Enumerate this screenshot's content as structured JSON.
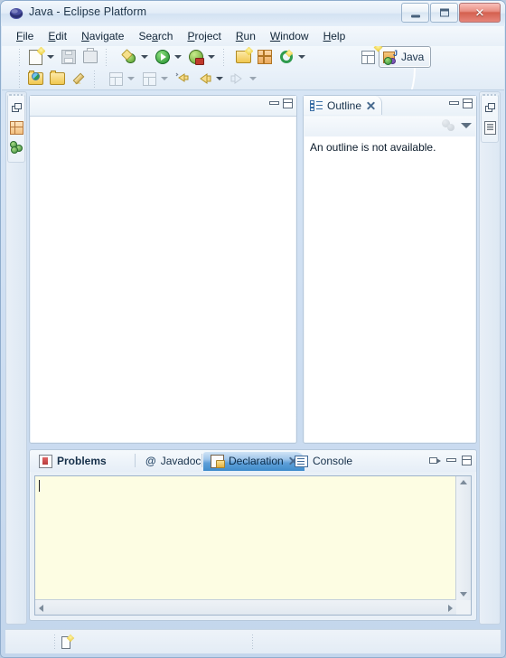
{
  "window": {
    "title": "Java - Eclipse Platform",
    "app_icon": "eclipse-sphere-icon",
    "controls": {
      "minimize": "minimize-button",
      "maximize": "maximize-button",
      "close_glyph": "✕"
    }
  },
  "menubar": {
    "items": [
      {
        "label": "File",
        "mnemonic": "F"
      },
      {
        "label": "Edit",
        "mnemonic": "E"
      },
      {
        "label": "Navigate",
        "mnemonic": "N"
      },
      {
        "label": "Search",
        "mnemonic": "a"
      },
      {
        "label": "Project",
        "mnemonic": "P"
      },
      {
        "label": "Run",
        "mnemonic": "R"
      },
      {
        "label": "Window",
        "mnemonic": "W"
      },
      {
        "label": "Help",
        "mnemonic": "H"
      }
    ]
  },
  "toolbar": {
    "row1": [
      {
        "icon": "new-wizard-icon",
        "dropdown": true
      },
      {
        "icon": "save-icon",
        "dropdown": false,
        "enabled": false
      },
      {
        "icon": "print-icon",
        "dropdown": false,
        "enabled": false
      },
      {
        "icon": "debug-icon",
        "dropdown": true
      },
      {
        "icon": "run-icon",
        "dropdown": true
      },
      {
        "icon": "external-tools-icon",
        "dropdown": true
      },
      {
        "icon": "import-icon",
        "dropdown": false
      },
      {
        "icon": "new-java-package-icon",
        "dropdown": false
      },
      {
        "icon": "refresh-icon",
        "dropdown": true
      }
    ],
    "row2": [
      {
        "icon": "open-type-icon",
        "dropdown": false
      },
      {
        "icon": "open-resource-icon",
        "dropdown": false
      },
      {
        "icon": "open-task-icon",
        "dropdown": false
      },
      {
        "icon": "annotation-icon",
        "dropdown": true,
        "enabled": false
      },
      {
        "icon": "next-annotation-icon",
        "dropdown": true,
        "enabled": false
      },
      {
        "icon": "last-edit-icon",
        "dropdown": false
      },
      {
        "icon": "back-icon",
        "dropdown": true
      },
      {
        "icon": "forward-icon",
        "dropdown": true,
        "enabled": false
      }
    ],
    "perspective": {
      "open_perspective_icon": "open-perspective-icon",
      "active_label": "Java",
      "active_icon": "java-perspective-icon"
    }
  },
  "fastview": {
    "left": [
      {
        "icon": "restore-icon"
      },
      {
        "icon": "package-explorer-icon"
      },
      {
        "icon": "type-hierarchy-icon"
      }
    ],
    "right": [
      {
        "icon": "restore-icon"
      },
      {
        "icon": "document-icon"
      }
    ]
  },
  "editor": {
    "tabs": [],
    "controls": {
      "minimize": "minimize-icon",
      "maximize": "maximize-icon"
    },
    "content": ""
  },
  "outline": {
    "tab_label": "Outline",
    "tab_icon": "outline-icon",
    "close_glyph": "close-x-icon",
    "view_toolbar": {
      "filter_icon": "hide-fields-filter-icon",
      "view_menu_icon": "view-menu-triangle-icon"
    },
    "message": "An outline is not available.",
    "controls": {
      "minimize": "minimize-icon",
      "maximize": "maximize-icon"
    }
  },
  "bottom_panel": {
    "tabs": [
      {
        "label": "Problems",
        "icon": "problems-icon",
        "selected": false,
        "bold": true,
        "closeable": false
      },
      {
        "label": "Javadoc",
        "icon": "javadoc-at-icon",
        "selected": false,
        "bold": false,
        "closeable": false
      },
      {
        "label": "Declaration",
        "icon": "declaration-icon",
        "selected": true,
        "bold": false,
        "closeable": true
      },
      {
        "label": "Console",
        "icon": "console-icon",
        "selected": false,
        "bold": false,
        "closeable": false
      }
    ],
    "controls": {
      "restore": "restore-icon",
      "minimize": "minimize-icon",
      "maximize": "maximize-icon"
    },
    "document": {
      "value": "",
      "background": "#fdfde3",
      "has_caret": true,
      "vertical_scrollbar": true,
      "horizontal_scrollbar": true
    }
  },
  "statusbar": {
    "icon": "editor-state-icon",
    "text": ""
  },
  "colors": {
    "titlebar_top": "#f2f7fc",
    "window_border": "#8fadcd",
    "selected_tab": "#3f8ccc",
    "doc_background": "#fdfde3",
    "pane_background": "#eaf1f8"
  }
}
